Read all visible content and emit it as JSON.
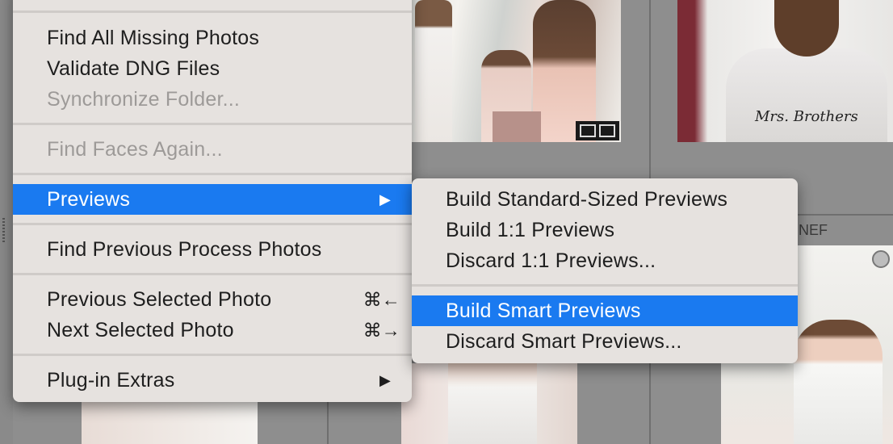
{
  "background": {
    "filename_label": "NEF",
    "photo_caption": "Mrs. Brothers"
  },
  "menu": {
    "items": [
      {
        "label": "Find All Missing Photos",
        "enabled": true
      },
      {
        "label": "Validate DNG Files",
        "enabled": true
      },
      {
        "label": "Synchronize Folder...",
        "enabled": false
      },
      {
        "label": "Find Faces Again...",
        "enabled": false
      },
      {
        "label": "Previews",
        "enabled": true,
        "highlighted": true,
        "submenu_arrow": "▶"
      },
      {
        "label": "Find Previous Process Photos",
        "enabled": true
      },
      {
        "label": "Previous Selected Photo",
        "enabled": true,
        "shortcut": "⌘←"
      },
      {
        "label": "Next Selected Photo",
        "enabled": true,
        "shortcut": "⌘→"
      },
      {
        "label": "Plug-in Extras",
        "enabled": true,
        "submenu_arrow": "▶"
      }
    ]
  },
  "submenu": {
    "items": [
      {
        "label": "Build Standard-Sized Previews",
        "enabled": true
      },
      {
        "label": "Build 1:1 Previews",
        "enabled": true
      },
      {
        "label": "Discard 1:1 Previews...",
        "enabled": true
      },
      {
        "label": "Build Smart Previews",
        "enabled": true,
        "highlighted": true
      },
      {
        "label": "Discard Smart Previews...",
        "enabled": true
      }
    ]
  },
  "colors": {
    "highlight": "#1a7af0",
    "menu_bg": "#e6e2df",
    "disabled_text": "#9d9a98"
  }
}
